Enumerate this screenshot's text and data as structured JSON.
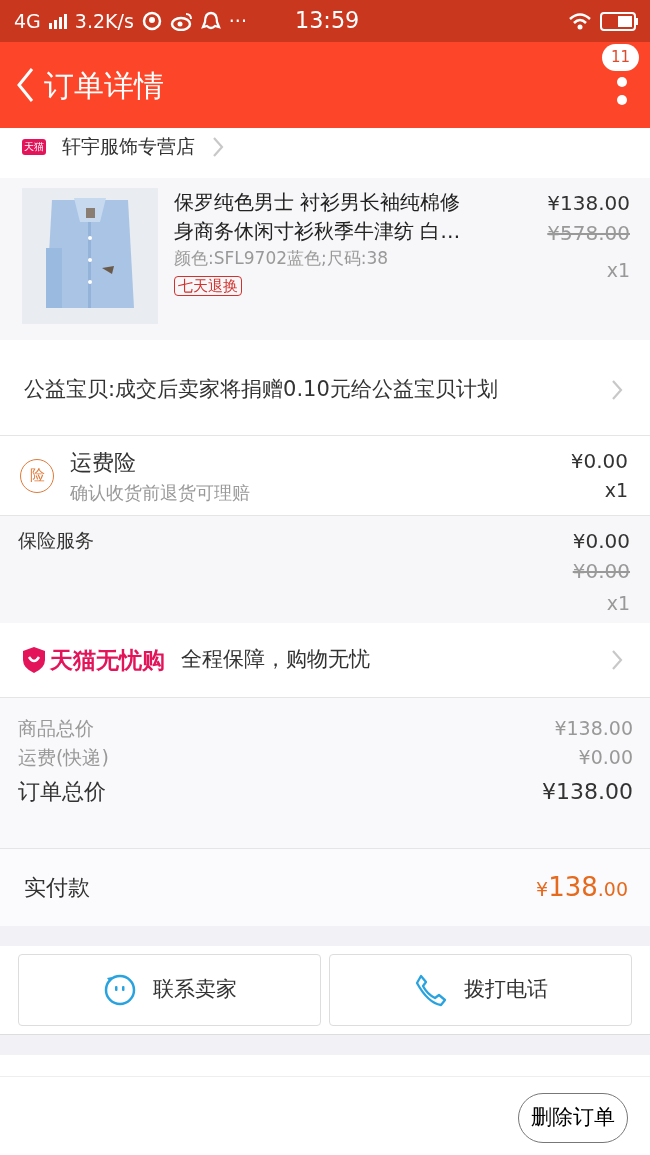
{
  "status_bar": {
    "network": "4G",
    "speed": "3.2K/s",
    "more": "···",
    "time": "13:59"
  },
  "header": {
    "title": "订单详情",
    "badge": "11"
  },
  "store": {
    "badge": "天猫",
    "name": "轩宇服饰专营店"
  },
  "product": {
    "title": "保罗纯色男士 衬衫男长袖纯棉修身商务休闲寸衫秋季牛津纺 白…",
    "sku": "颜色:SFL9702蓝色;尺码:38",
    "tag": "七天退换",
    "price": "¥138.00",
    "original_price": "¥578.00",
    "quantity": "x1"
  },
  "charity": {
    "text": "公益宝贝:成交后卖家将捐赠0.10元给公益宝贝计划"
  },
  "shipping_insurance": {
    "icon_text": "险",
    "title": "运费险",
    "subtitle": "确认收货前退货可理赔",
    "price": "¥0.00",
    "quantity": "x1"
  },
  "insurance_service": {
    "title": "保险服务",
    "price": "¥0.00",
    "original_price": "¥0.00",
    "quantity": "x1"
  },
  "guarantee": {
    "brand": "天猫无忧购",
    "text": "全程保障，购物无忧"
  },
  "summary": [
    {
      "kind": "minor",
      "label": "商品总价",
      "value": "¥138.00"
    },
    {
      "kind": "minor",
      "label": "运费(快递)",
      "value": "¥0.00"
    },
    {
      "kind": "total",
      "label": "订单总价",
      "value": "¥138.00"
    }
  ],
  "payment": {
    "label": "实付款",
    "currency": "¥",
    "amount": "138",
    "decimal": ".00"
  },
  "actions": [
    {
      "kind": "chat",
      "label": "联系卖家"
    },
    {
      "kind": "phone",
      "label": "拨打电话"
    }
  ],
  "footer": {
    "button": "删除订单"
  }
}
